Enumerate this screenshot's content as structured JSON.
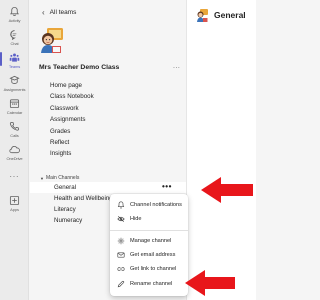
{
  "rail": {
    "items": [
      {
        "icon": "bell-icon",
        "label": "Activity"
      },
      {
        "icon": "chat-icon",
        "label": "Chat"
      },
      {
        "icon": "teams-icon",
        "label": "Teams",
        "active": true
      },
      {
        "icon": "assignments-icon",
        "label": "Assignments"
      },
      {
        "icon": "calendar-icon",
        "label": "Calendar"
      },
      {
        "icon": "calls-icon",
        "label": "Calls"
      },
      {
        "icon": "onedrive-icon",
        "label": "OneDrive"
      },
      {
        "icon": "more-icon",
        "label": "..."
      },
      {
        "icon": "apps-icon",
        "label": "Apps"
      }
    ]
  },
  "panel": {
    "back_label": "All teams",
    "team_name": "Mrs Teacher Demo Class",
    "team_more": "...",
    "nav_items": [
      "Home page",
      "Class Notebook",
      "Classwork",
      "Assignments",
      "Grades",
      "Reflect",
      "Insights"
    ],
    "section_title": "Main Channels",
    "channels": [
      {
        "name": "General",
        "selected": true
      },
      {
        "name": "Health and Wellbeing"
      },
      {
        "name": "Literacy"
      },
      {
        "name": "Numeracy"
      }
    ],
    "channel_more": "•••"
  },
  "main": {
    "title": "General"
  },
  "context_menu": {
    "items": [
      {
        "icon": "bell-icon",
        "label": "Channel notifications"
      },
      {
        "icon": "hide-icon",
        "label": "Hide"
      },
      {
        "icon": "gear-icon",
        "label": "Manage channel"
      },
      {
        "icon": "mail-icon",
        "label": "Get email address"
      },
      {
        "icon": "link-icon",
        "label": "Get link to channel"
      },
      {
        "icon": "pencil-icon",
        "label": "Rename channel"
      }
    ]
  },
  "colors": {
    "accent": "#5b5fc7",
    "annotation_arrow": "#e8161b",
    "rail_bg": "#ebebeb",
    "panel_bg": "#f5f5f5"
  }
}
